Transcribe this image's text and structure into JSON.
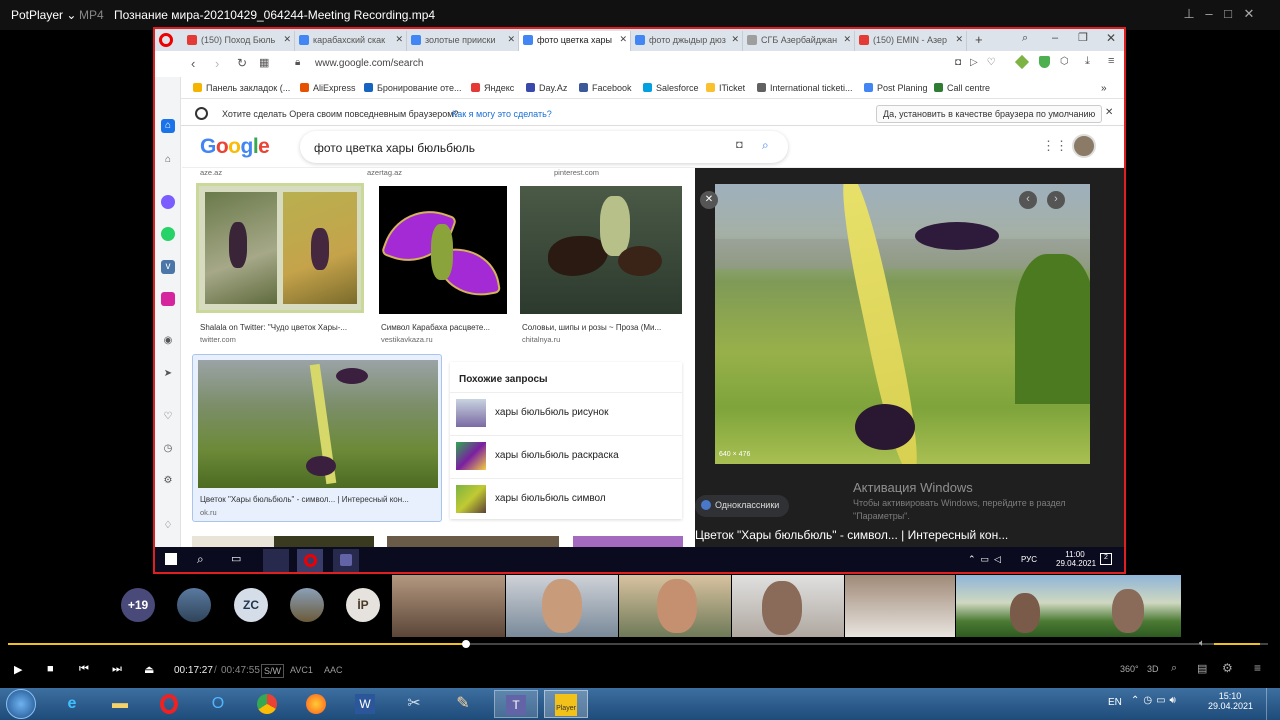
{
  "player": {
    "app_name": "PotPlayer",
    "format": "MP4",
    "file_title": "Познание мира-20210429_064244-Meeting Recording.mp4",
    "time_current": "00:17:27",
    "time_sep": "/",
    "time_total": "00:47:55",
    "codec1": "S/W",
    "codec2": "AVC1",
    "codec3": "AAC",
    "progress": 0.364,
    "volume": 0.85,
    "info_360": "360°",
    "info_3d": "3D"
  },
  "browser": {
    "tabs": [
      {
        "label": "(150) Поход Бюль",
        "color": "#e53935"
      },
      {
        "label": "карабахский скак",
        "color": "#4285f4"
      },
      {
        "label": "золотые прииски",
        "color": "#4285f4"
      },
      {
        "label": "фото цветка хары",
        "color": "#4285f4",
        "active": true
      },
      {
        "label": "фото джыдыр дюз",
        "color": "#4285f4"
      },
      {
        "label": "СГБ Азербайджан",
        "color": "#9e9e9e"
      },
      {
        "label": "(150) EMIN - Азер",
        "color": "#e53935"
      }
    ],
    "url": "www.google.com/search",
    "bookmarks": [
      {
        "label": "Панель закладок (...",
        "color": "#f5b400"
      },
      {
        "label": "AliExpress",
        "color": "#e65100"
      },
      {
        "label": "Бронирование оте...",
        "color": "#1565c0"
      },
      {
        "label": "Яндекс",
        "color": "#e53935"
      },
      {
        "label": "Day.Az",
        "color": "#3949ab"
      },
      {
        "label": "Facebook",
        "color": "#3b5998"
      },
      {
        "label": "Salesforce",
        "color": "#00a1e0"
      },
      {
        "label": "ITicket",
        "color": "#fbc02d"
      },
      {
        "label": "International ticketi...",
        "color": "#616161"
      },
      {
        "label": "Post Planing",
        "color": "#4285f4"
      },
      {
        "label": "Call centre",
        "color": "#2e7d32"
      }
    ],
    "infobar_text": "Хотите сделать Opera своим повседневным браузером?",
    "infobar_link": "Как я могу это сделать?",
    "infobar_button": "Да, установить в качестве браузера по умолчанию"
  },
  "google": {
    "logo": "Google",
    "query": "фото цветка хары бюльбюль",
    "top_sources": [
      "aze.az",
      "azertag.az",
      "pinterest.com"
    ],
    "results": [
      {
        "caption": "Shalala on Twitter: \"Чудо цветок Хары-...",
        "source": "twitter.com"
      },
      {
        "caption": "Символ Карабаха расцвете...",
        "source": "vestikavkaza.ru"
      },
      {
        "caption": "Соловьи, шипы и розы ~ Проза (Ми...",
        "source": "chitalnya.ru"
      },
      {
        "caption": "Цветок \"Хары бюльбюль\" - символ... | Интересный кон...",
        "source": "ok.ru"
      }
    ],
    "related_title": "Похожие запросы",
    "related": [
      "хары бюльбюль рисунок",
      "хары бюльбюль раскраска",
      "хары бюльбюль символ"
    ],
    "preview_size": "640 × 476",
    "preview_source": "Одноклассники",
    "preview_title": "Цветок \"Хары бюльбюль\" - символ... | Интересный кон...",
    "activation_title": "Активация Windows",
    "activation_text": "Чтобы активировать Windows, перейдите в раздел \"Параметры\"."
  },
  "inner_taskbar": {
    "lang": "РУС",
    "time": "11:00",
    "date": "29.04.2021",
    "notif": "2"
  },
  "participants": {
    "more": "+19",
    "initials1": "ZC",
    "initials2": "İP"
  },
  "taskbar": {
    "lang": "EN",
    "time": "15:10",
    "date": "29.04.2021",
    "player_label": "Player"
  }
}
